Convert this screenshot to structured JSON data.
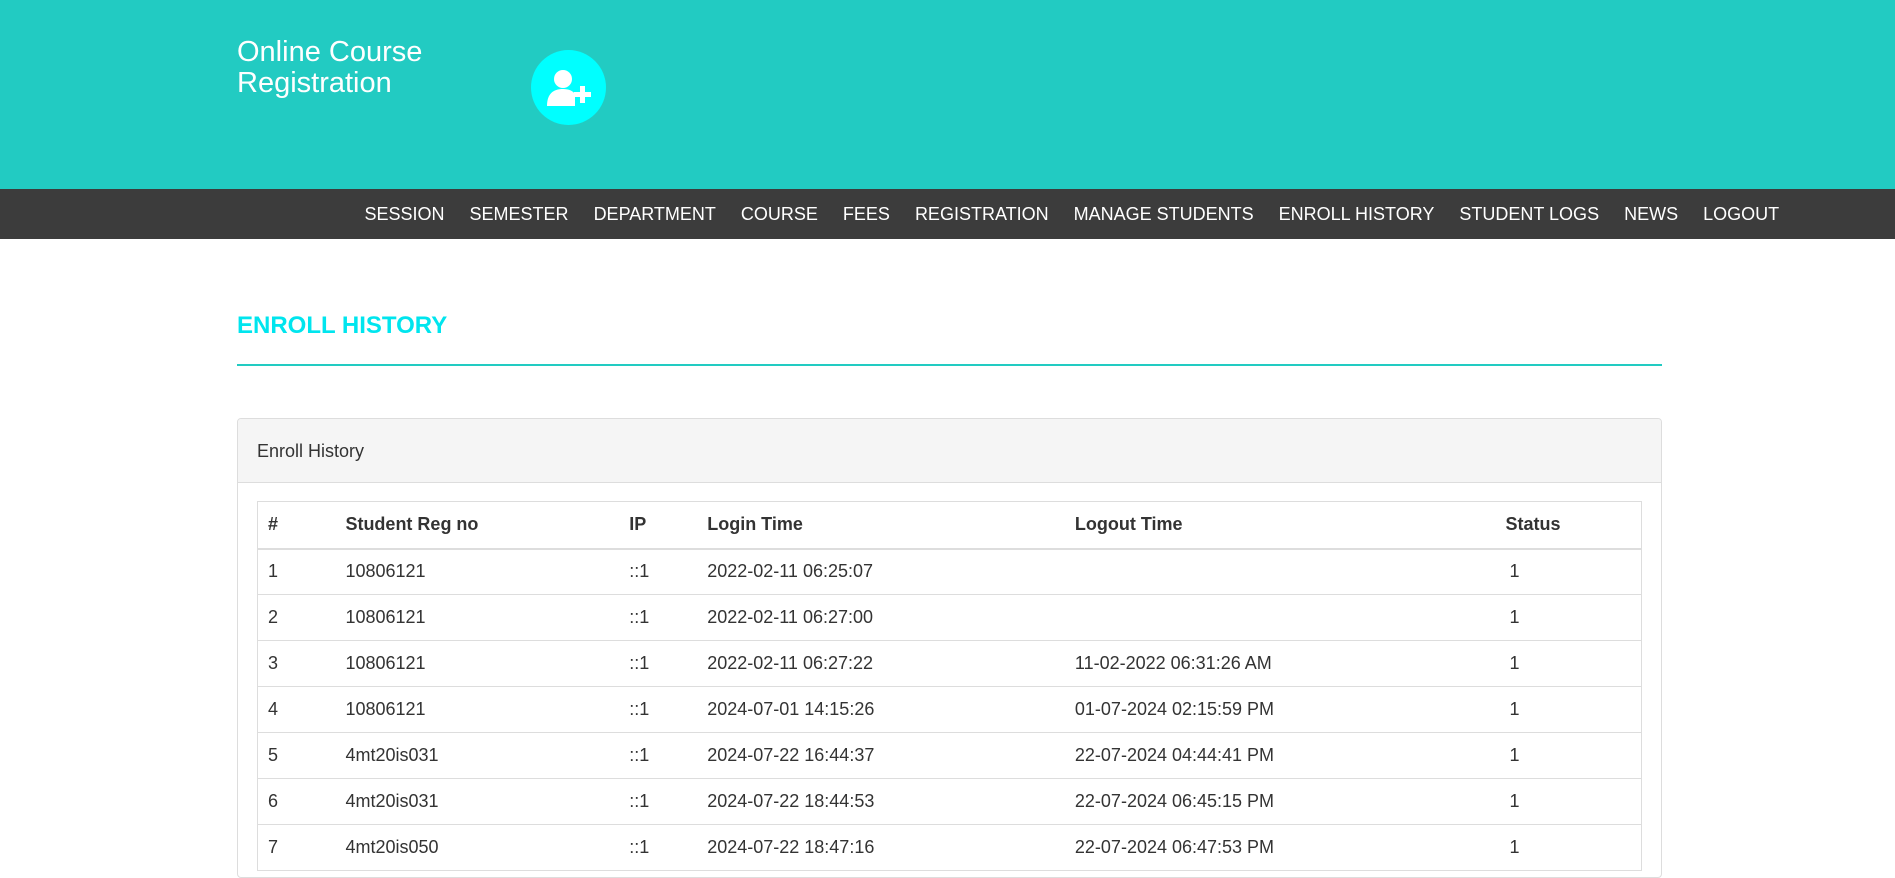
{
  "header": {
    "brand_line1": "Online Course",
    "brand_line2": "Registration",
    "logo_icon": "user-plus-icon"
  },
  "colors": {
    "header_bg": "#22cbc2",
    "logo_bg": "#00ffff",
    "navbar_bg": "#3c3c3c",
    "title_color": "#00e5ee"
  },
  "nav": {
    "items": [
      "SESSION",
      "SEMESTER",
      "DEPARTMENT",
      "COURSE",
      "FEES",
      "REGISTRATION",
      "MANAGE STUDENTS",
      "ENROLL HISTORY",
      "STUDENT LOGS",
      "NEWS",
      "LOGOUT"
    ]
  },
  "main": {
    "title": "ENROLL HISTORY",
    "panel_heading": "Enroll History"
  },
  "table": {
    "headers": [
      "#",
      "Student Reg no",
      "IP",
      "Login Time",
      "Logout Time",
      "Status"
    ],
    "rows": [
      [
        "1",
        "10806121",
        "::1",
        "2022-02-11 06:25:07",
        "",
        "1"
      ],
      [
        "2",
        "10806121",
        "::1",
        "2022-02-11 06:27:00",
        "",
        "1"
      ],
      [
        "3",
        "10806121",
        "::1",
        "2022-02-11 06:27:22",
        "11-02-2022 06:31:26 AM",
        "1"
      ],
      [
        "4",
        "10806121",
        "::1",
        "2024-07-01 14:15:26",
        "01-07-2024 02:15:59 PM",
        "1"
      ],
      [
        "5",
        "4mt20is031",
        "::1",
        "2024-07-22 16:44:37",
        "22-07-2024 04:44:41 PM",
        "1"
      ],
      [
        "6",
        "4mt20is031",
        "::1",
        "2024-07-22 18:44:53",
        "22-07-2024 06:45:15 PM",
        "1"
      ],
      [
        "7",
        "4mt20is050",
        "::1",
        "2024-07-22 18:47:16",
        "22-07-2024 06:47:53 PM",
        "1"
      ]
    ]
  }
}
